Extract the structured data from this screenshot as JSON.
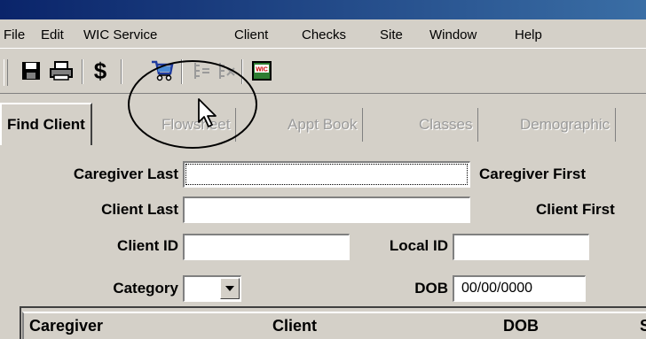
{
  "menu": [
    "File",
    "Edit",
    "WIC Service",
    "Client",
    "Checks",
    "Site",
    "Window",
    "Help"
  ],
  "toolbar": {
    "buttons": [
      "save-icon",
      "print-icon",
      "dollar-icon",
      "cart-icon",
      "list-add-icon",
      "list-remove-icon",
      "wic-card-icon"
    ],
    "dollar_glyph": "$",
    "wic_text": "WIC"
  },
  "tabs": [
    "Find Client",
    "Flowsheet",
    "Appt Book",
    "Classes",
    "Demographic"
  ],
  "form": {
    "caregiver_last": "Caregiver Last",
    "caregiver_first": "Caregiver First",
    "client_last": "Client Last",
    "client_first": "Client First",
    "client_id": "Client ID",
    "local_id": "Local ID",
    "category": "Category",
    "dob": "DOB",
    "dob_value": "00/00/0000"
  },
  "grid": {
    "columns": [
      "Caregiver",
      "Client",
      "DOB",
      "S"
    ]
  }
}
